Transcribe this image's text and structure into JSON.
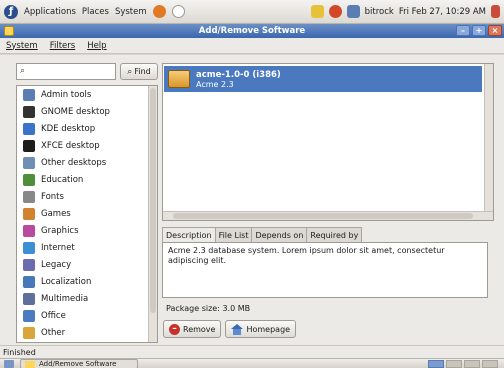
{
  "panel": {
    "menus": [
      "Applications",
      "Places",
      "System"
    ],
    "user": "bitrock",
    "clock": "Fri Feb 27, 10:29 AM"
  },
  "window": {
    "title": "Add/Remove Software"
  },
  "menubar": {
    "items": [
      "System",
      "Filters",
      "Help"
    ]
  },
  "search": {
    "value": "",
    "placeholder": "",
    "find_label": "Find"
  },
  "groups": [
    {
      "label": "Admin tools",
      "color": "#5a7db3"
    },
    {
      "label": "GNOME desktop",
      "color": "#333333"
    },
    {
      "label": "KDE desktop",
      "color": "#3a73c9"
    },
    {
      "label": "XFCE desktop",
      "color": "#1c1c1c"
    },
    {
      "label": "Other desktops",
      "color": "#6f8fb6"
    },
    {
      "label": "Education",
      "color": "#4f8f3a"
    },
    {
      "label": "Fonts",
      "color": "#888888"
    },
    {
      "label": "Games",
      "color": "#d0822c"
    },
    {
      "label": "Graphics",
      "color": "#b94aa0"
    },
    {
      "label": "Internet",
      "color": "#3c8fd6"
    },
    {
      "label": "Legacy",
      "color": "#6b6bb0"
    },
    {
      "label": "Localization",
      "color": "#4778b8"
    },
    {
      "label": "Multimedia",
      "color": "#5e6f9a"
    },
    {
      "label": "Office",
      "color": "#4c7cc0"
    },
    {
      "label": "Other",
      "color": "#d8a63a"
    }
  ],
  "package": {
    "name": "acme-1.0-0 (i386)",
    "summary": "Acme 2.3"
  },
  "tabs": [
    "Description",
    "File List",
    "Depends on",
    "Required by"
  ],
  "description": "Acme 2.3 database system.  Lorem ipsum dolor sit amet, consectetur adipiscing elit.",
  "package_size": "Package size: 3.0 MB",
  "buttons": {
    "remove": "Remove",
    "homepage": "Homepage"
  },
  "status": "Finished",
  "taskbar": {
    "window_button": "Add/Remove Software"
  },
  "colors": {
    "selection": "#4a79c0",
    "titlebar": "#3b67ad"
  }
}
